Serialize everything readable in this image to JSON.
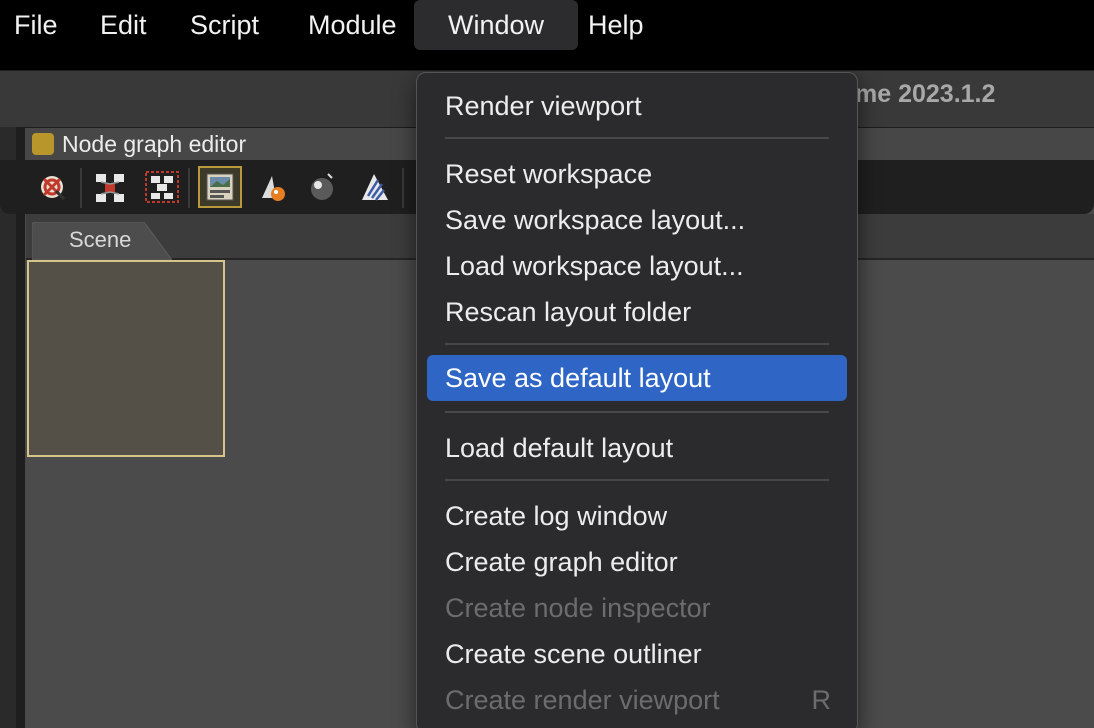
{
  "menubar": {
    "items": [
      {
        "label": "File"
      },
      {
        "label": "Edit"
      },
      {
        "label": "Script"
      },
      {
        "label": "Module"
      },
      {
        "label": "Window"
      },
      {
        "label": "Help"
      }
    ],
    "active": "Window"
  },
  "app": {
    "title_partial": "me 2023.1.2"
  },
  "panel": {
    "title": "Node graph editor",
    "swatch_color": "#b8962c",
    "tabs": [
      {
        "label": "Scene"
      }
    ],
    "toolbar_icons": [
      "layout-nodes-icon",
      "arrange-nodes-icon",
      "select-nodes-icon",
      "scene-view-icon",
      "material-icon",
      "sphere-icon",
      "pattern-icon"
    ],
    "selected_tool": "scene-view-icon"
  },
  "window_menu": {
    "items": [
      {
        "label": "Render viewport",
        "enabled": true
      },
      {
        "label": "Reset workspace",
        "enabled": true
      },
      {
        "label": "Save workspace layout...",
        "enabled": true
      },
      {
        "label": "Load workspace layout...",
        "enabled": true
      },
      {
        "label": "Rescan layout folder",
        "enabled": true
      },
      {
        "label": "Save as default layout",
        "enabled": true,
        "highlighted": true
      },
      {
        "label": "Load default layout",
        "enabled": true
      },
      {
        "label": "Create log window",
        "enabled": true
      },
      {
        "label": "Create graph editor",
        "enabled": true
      },
      {
        "label": "Create node inspector",
        "enabled": false
      },
      {
        "label": "Create scene outliner",
        "enabled": true
      },
      {
        "label": "Create render viewport",
        "enabled": false,
        "shortcut": "R"
      }
    ]
  },
  "colors": {
    "highlight": "#2f66c6",
    "menu_bg": "#2b2b2d",
    "disabled_text": "#6c6c6e"
  }
}
